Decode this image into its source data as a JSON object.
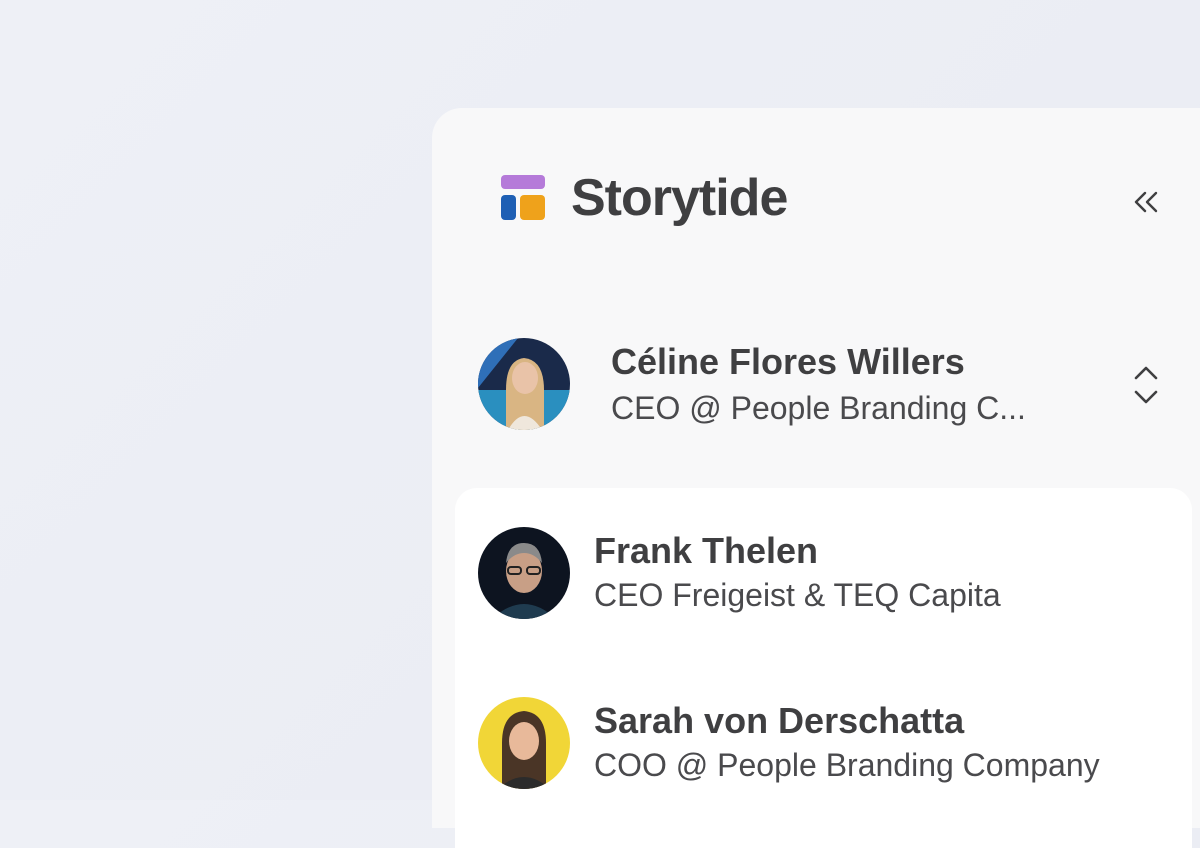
{
  "brand": {
    "name": "Storytide",
    "logo_colors": [
      "#b57ad9",
      "#1e5fb4",
      "#efa21b"
    ]
  },
  "sidebar": {
    "collapse_icon": "chevrons-left-icon"
  },
  "current_user": {
    "name": "Céline Flores Willers",
    "role": "CEO @ People Branding C...",
    "switcher_icon": "chevron-up-down-icon"
  },
  "accounts": [
    {
      "name": "Frank Thelen",
      "role": "CEO Freigeist & TEQ Capita"
    },
    {
      "name": "Sarah von Derschatta",
      "role": "COO @ People Branding Company"
    }
  ]
}
